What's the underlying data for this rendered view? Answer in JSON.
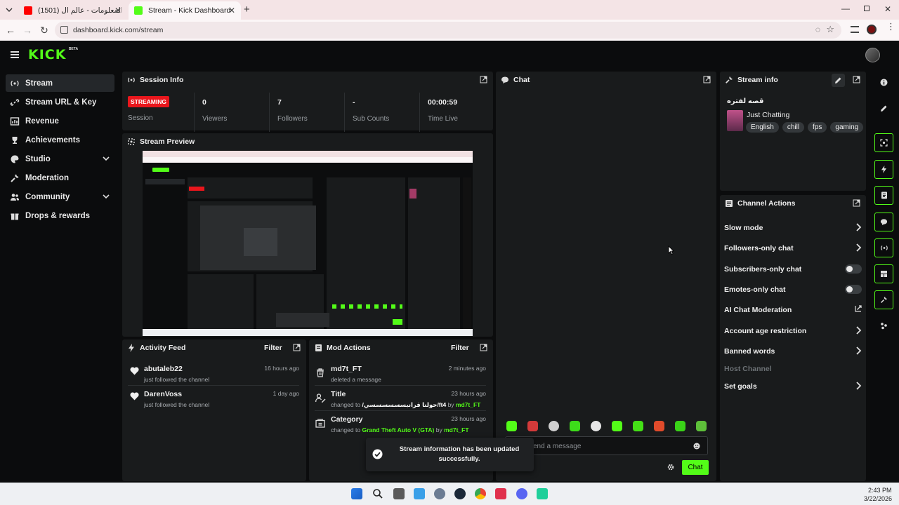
{
  "browser": {
    "tabs": [
      {
        "title": "(1501) تحدي المعلومات - عالم ال",
        "active": false
      },
      {
        "title": "Stream - Kick Dashboard",
        "active": true
      }
    ],
    "url": "dashboard.kick.com/stream"
  },
  "header": {
    "logo": "KICK",
    "badge": "BETA"
  },
  "sidebar": {
    "items": [
      {
        "label": "Stream",
        "icon": "broadcast-icon",
        "active": true
      },
      {
        "label": "Stream URL & Key",
        "icon": "link-icon"
      },
      {
        "label": "Revenue",
        "icon": "revenue-icon"
      },
      {
        "label": "Achievements",
        "icon": "trophy-icon"
      },
      {
        "label": "Studio",
        "icon": "palette-icon",
        "expandable": true
      },
      {
        "label": "Moderation",
        "icon": "wrench-icon"
      },
      {
        "label": "Community",
        "icon": "users-icon",
        "expandable": true
      },
      {
        "label": "Drops & rewards",
        "icon": "gift-icon"
      }
    ]
  },
  "session": {
    "title": "Session Info",
    "status_badge": "STREAMING",
    "status_label": "Session",
    "stats": [
      {
        "value": "0",
        "label": "Viewers"
      },
      {
        "value": "7",
        "label": "Followers"
      },
      {
        "value": "-",
        "label": "Sub Counts"
      },
      {
        "value": "00:00:59",
        "label": "Time Live"
      }
    ]
  },
  "preview": {
    "title": "Stream Preview"
  },
  "activity": {
    "title": "Activity Feed",
    "filter": "Filter",
    "items": [
      {
        "name": "abutaleb22",
        "text": "just followed the channel",
        "time": "16 hours ago"
      },
      {
        "name": "DarenVoss",
        "text": "just followed the channel",
        "time": "1 day ago"
      }
    ]
  },
  "mod_actions": {
    "title": "Mod Actions",
    "filter": "Filter",
    "items": [
      {
        "name": "md7t_FT",
        "prefix": "deleted a message",
        "value": "",
        "by": "",
        "actor": "",
        "time": "2 minutes ago",
        "icon": "trash-icon"
      },
      {
        "name": "Title",
        "prefix": "changed to",
        "value": "/حولنا قرانبسسسسسسي/ft4",
        "by": "by",
        "actor": "md7t_FT",
        "time": "23 hours ago",
        "icon": "user-edit-icon"
      },
      {
        "name": "Category",
        "prefix": "changed to",
        "value": "Grand Theft Auto V (GTA)",
        "by": "by",
        "actor": "md7t_FT",
        "time": "23 hours ago",
        "icon": "category-icon"
      }
    ]
  },
  "chat": {
    "title": "Chat",
    "placeholder": "end a message",
    "send_label": "Chat"
  },
  "toast": {
    "message": "Stream information has been updated successfully."
  },
  "stream_info": {
    "title": "Stream info",
    "stream_title": "قصه لفتره",
    "category": "Just Chatting",
    "tags": [
      "English",
      "chill",
      "fps",
      "gaming"
    ]
  },
  "channel_actions": {
    "title": "Channel Actions",
    "items": [
      {
        "label": "Slow mode",
        "control": "arrow"
      },
      {
        "label": "Followers-only chat",
        "control": "arrow"
      },
      {
        "label": "Subscribers-only chat",
        "control": "toggle"
      },
      {
        "label": "Emotes-only chat",
        "control": "toggle"
      },
      {
        "label": "AI Chat Moderation",
        "control": "external"
      },
      {
        "label": "Account age restriction",
        "control": "arrow"
      },
      {
        "label": "Banned words",
        "control": "arrow"
      },
      {
        "label": "Host Channel",
        "control": "disabled"
      },
      {
        "label": "Set goals",
        "control": "arrow"
      }
    ]
  },
  "taskbar": {
    "time": "2:43 PM",
    "date": "3/22/2026"
  },
  "colors": {
    "accent": "#53fc18",
    "panel": "#191b1c",
    "background": "#0b0c0d",
    "streaming_badge": "#e9161c"
  }
}
